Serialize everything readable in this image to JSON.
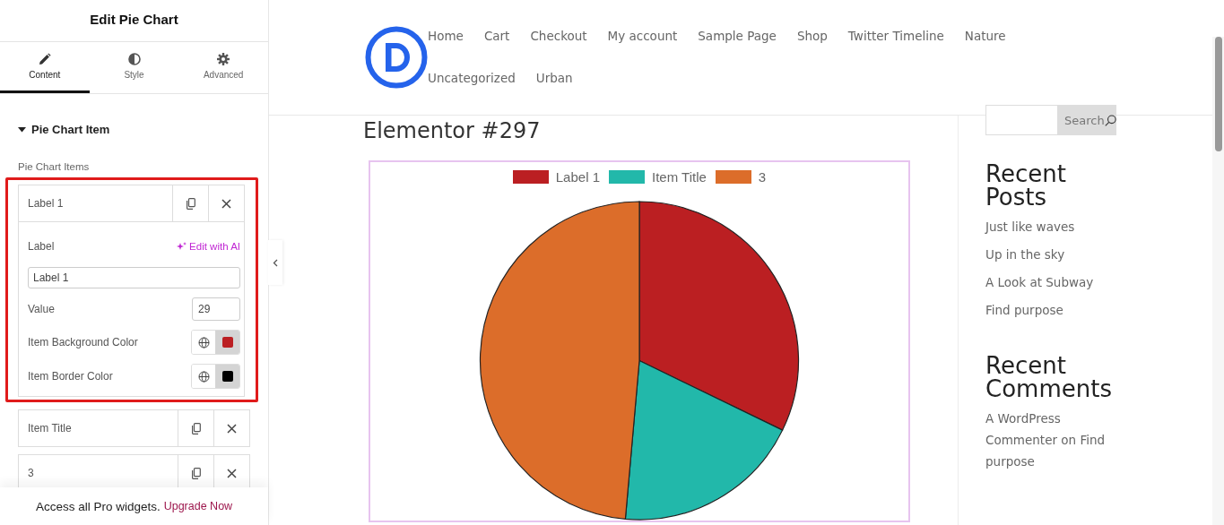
{
  "panel": {
    "title": "Edit Pie Chart",
    "tabs": [
      {
        "label": "Content",
        "kind": "pencil",
        "selected": true
      },
      {
        "label": "Style",
        "kind": "contrast",
        "selected": false
      },
      {
        "label": "Advanced",
        "kind": "gear",
        "selected": false
      }
    ],
    "section": {
      "title": "Pie Chart Item",
      "expanded": true
    },
    "repeater_label": "Pie Chart Items",
    "items": [
      {
        "title": "Label 1",
        "expanded": true,
        "highlighted": true,
        "fields": {
          "label_caption": "Label",
          "ai_link": "Edit with AI",
          "label_value": "Label 1",
          "value_caption": "Value",
          "value": "29",
          "colors": [
            {
              "caption": "Item Background Color",
              "color": "#bb1f22"
            },
            {
              "caption": "Item Border Color",
              "color": "#000000"
            }
          ]
        }
      },
      {
        "title": "Item Title",
        "expanded": false,
        "highlighted": false
      },
      {
        "title": "3",
        "expanded": false,
        "highlighted": false
      }
    ],
    "promo": {
      "text": "Access all Pro widgets.",
      "link": "Upgrade Now"
    }
  },
  "site": {
    "nav": [
      "Home",
      "Cart",
      "Checkout",
      "My account",
      "Sample Page",
      "Shop",
      "Twitter Timeline",
      "Nature",
      "Uncategorized",
      "Urban"
    ],
    "page_title": "Elementor #297",
    "legend": [
      {
        "label": "Label 1",
        "color": "#bb1f22"
      },
      {
        "label": "Item Title",
        "color": "#22b8aa"
      },
      {
        "label": "3",
        "color": "#dc6d2a"
      }
    ],
    "search_button": "Search",
    "widgets": [
      {
        "title": "Recent Posts",
        "links": [
          "Just like waves",
          "Up in the sky",
          "A Look at Subway",
          "Find purpose"
        ]
      },
      {
        "title": "Recent Comments",
        "links": [
          "A WordPress Commenter on Find purpose"
        ]
      }
    ]
  }
}
